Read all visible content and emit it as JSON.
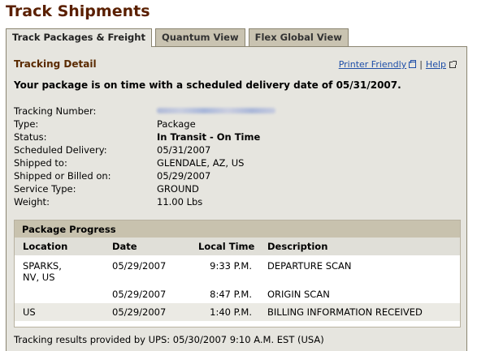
{
  "page_title": "Track Shipments",
  "tabs": [
    {
      "label": "Track Packages & Freight",
      "active": true
    },
    {
      "label": "Quantum View",
      "active": false
    },
    {
      "label": "Flex Global View",
      "active": false
    }
  ],
  "panel": {
    "title": "Tracking Detail",
    "links": {
      "printer": "Printer Friendly",
      "help": "Help"
    },
    "summary": "Your package is on time with a scheduled delivery date of 05/31/2007.",
    "info": [
      {
        "label": "Tracking Number:",
        "value": "",
        "blurred": true
      },
      {
        "label": "Type:",
        "value": "Package"
      },
      {
        "label": "Status:",
        "value": "In Transit - On Time",
        "bold": true
      },
      {
        "label": "Scheduled Delivery:",
        "value": "05/31/2007"
      },
      {
        "label": "Shipped to:",
        "value": "GLENDALE, AZ, US"
      },
      {
        "label": "Shipped or Billed on:",
        "value": "05/29/2007"
      },
      {
        "label": "Service Type:",
        "value": "GROUND"
      },
      {
        "label": "Weight:",
        "value": "11.00 Lbs"
      }
    ]
  },
  "progress": {
    "title": "Package Progress",
    "columns": [
      "Location",
      "Date",
      "Local Time",
      "Description"
    ],
    "rows": [
      {
        "location": "SPARKS,",
        "location2": "NV,  US",
        "date": "05/29/2007",
        "time": "9:33 P.M.",
        "description": "DEPARTURE SCAN"
      },
      {
        "location": "",
        "location2": "",
        "date": "05/29/2007",
        "time": "8:47 P.M.",
        "description": "ORIGIN SCAN"
      },
      {
        "location": "US",
        "location2": "",
        "date": "05/29/2007",
        "time": "1:40 P.M.",
        "description": "BILLING INFORMATION RECEIVED"
      }
    ]
  },
  "footer": "Tracking results provided by UPS:  05/30/2007 9:10 A.M.  EST (USA)"
}
